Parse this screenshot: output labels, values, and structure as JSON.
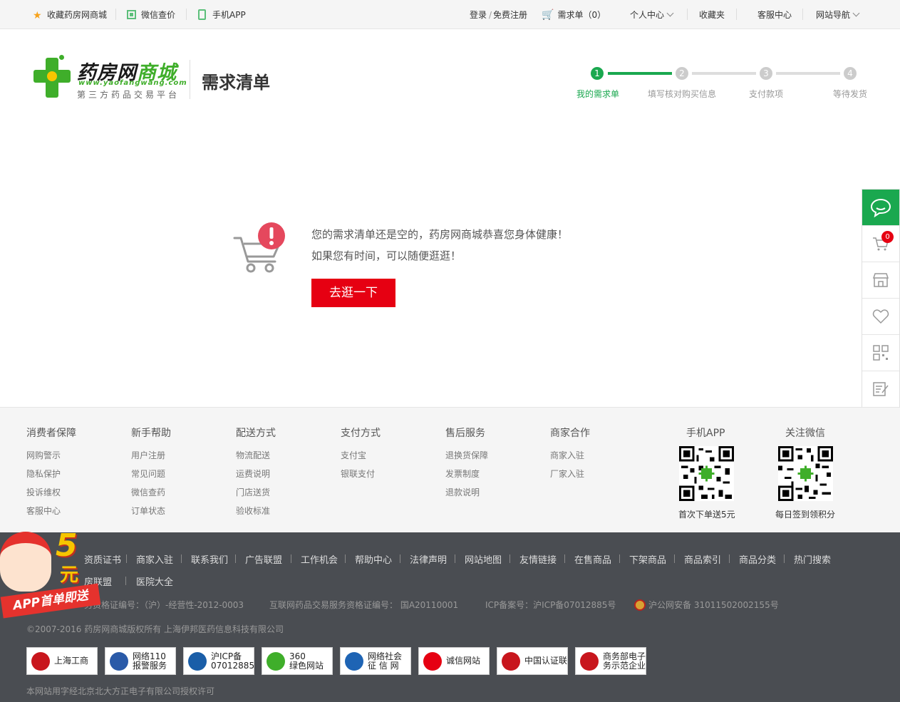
{
  "topbar": {
    "favorite": "收藏药房网商城",
    "wechat_price": "微信查价",
    "mobile_app": "手机APP",
    "login": "登录",
    "slash": "/",
    "register": "免费注册",
    "cart_label": "需求单",
    "cart_count": "（0）",
    "personal": "个人中心",
    "collection": "收藏夹",
    "service": "客服中心",
    "site_nav": "网站导航"
  },
  "header": {
    "logo_title_a": "药房网",
    "logo_title_b": "商城",
    "logo_url": "www.yaofangwang.com",
    "logo_sub": "第三方药品交易平台",
    "page_title": "需求清单"
  },
  "steps": [
    {
      "num": "1",
      "label": "我的需求单"
    },
    {
      "num": "2",
      "label": "填写核对购买信息"
    },
    {
      "num": "3",
      "label": "支付款项"
    },
    {
      "num": "4",
      "label": "等待发货"
    }
  ],
  "empty": {
    "line1": "您的需求清单还是空的，药房网商城恭喜您身体健康！",
    "line2": "如果您有时间，可以随便逛逛！",
    "button": "去逛一下"
  },
  "sidebar": {
    "cart_badge": "0"
  },
  "footer": {
    "columns": [
      {
        "title": "消费者保障",
        "links": [
          "网购警示",
          "隐私保护",
          "投诉维权",
          "客服中心"
        ]
      },
      {
        "title": "新手帮助",
        "links": [
          "用户注册",
          "常见问题",
          "微信查药",
          "订单状态"
        ]
      },
      {
        "title": "配送方式",
        "links": [
          "物流配送",
          "运费说明",
          "门店送货",
          "验收标准"
        ]
      },
      {
        "title": "支付方式",
        "links": [
          "支付宝",
          "银联支付"
        ]
      },
      {
        "title": "售后服务",
        "links": [
          "退换货保障",
          "发票制度",
          "退款说明"
        ]
      },
      {
        "title": "商家合作",
        "links": [
          "商家入驻",
          "厂家入驻"
        ]
      }
    ],
    "app": {
      "title": "手机APP",
      "caption": "首次下单送5元"
    },
    "wechat": {
      "title": "关注微信",
      "caption": "每日签到领积分"
    }
  },
  "bottom": {
    "links": [
      "资质证书",
      "商家入驻",
      "联系我们",
      "广告联盟",
      "工作机会",
      "帮助中心",
      "法律声明",
      "网站地图",
      "友情链接",
      "在售商品",
      "下架商品",
      "商品索引",
      "商品分类",
      "热门搜索"
    ],
    "links2": [
      "房联盟",
      "医院大全"
    ],
    "licenses": [
      "务资格证编号：（沪）-经营性-2012-0003",
      "互联网药品交易服务资格证编号：  国A20110001",
      "ICP备案号：沪ICP备07012885号",
      "沪公网安备 31011502002155号"
    ],
    "copyright": "©2007-2016 药房网商城版权所有 上海伊邦医药信息科技有限公司",
    "font_license": "本网站用字经北京北大方正电子有限公司授权许可",
    "badges": [
      {
        "line1": "上海工商",
        "line2": ""
      },
      {
        "line1": "网络110",
        "line2": "报警服务"
      },
      {
        "line1": "沪ICP备",
        "line2": "07012885号"
      },
      {
        "line1": "360",
        "line2": "绿色网站"
      },
      {
        "line1": "网络社会",
        "line2": "征 信 网"
      },
      {
        "line1": "诚信网站",
        "line2": ""
      },
      {
        "line1": "中国认证联盟",
        "line2": ""
      },
      {
        "line1": "商务部电子商",
        "line2": "务示范企业"
      }
    ]
  },
  "promo": {
    "num": "5",
    "unit": "元",
    "banner": "APP首单即送"
  }
}
